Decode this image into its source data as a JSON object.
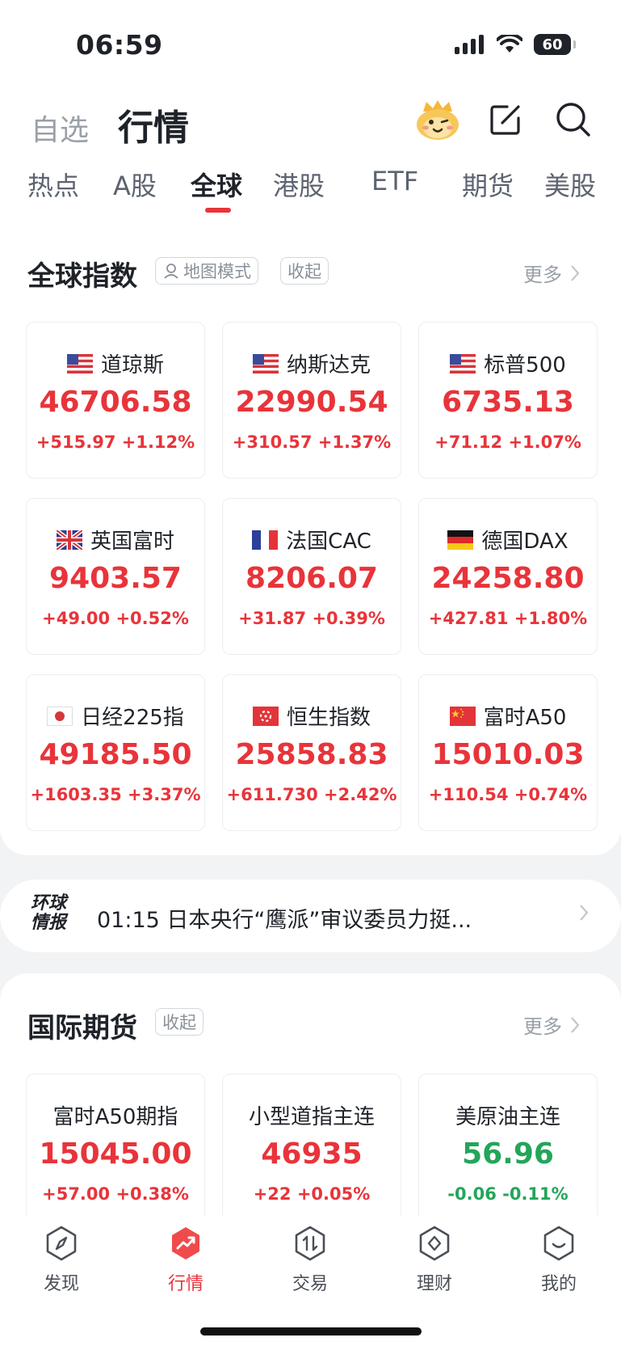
{
  "status_bar": {
    "time": "06:59",
    "battery": "60"
  },
  "header": {
    "tab_watchlist": "自选",
    "tab_market": "行情"
  },
  "market_tabs": [
    "热点",
    "A股",
    "全球",
    "港股",
    "ETF",
    "期货",
    "美股"
  ],
  "global_index": {
    "title": "全球指数",
    "map_mode": "地图模式",
    "collapse": "收起",
    "more": "更多",
    "cards": [
      {
        "name": "道琼斯",
        "flag": "us-flag-icon",
        "price": "46706.58",
        "change": "+515.97 +1.12%"
      },
      {
        "name": "纳斯达克",
        "flag": "us-flag-icon",
        "price": "22990.54",
        "change": "+310.57 +1.37%"
      },
      {
        "name": "标普500",
        "flag": "us-flag-icon",
        "price": "6735.13",
        "change": "+71.12 +1.07%"
      },
      {
        "name": "英国富时",
        "flag": "uk-flag-icon",
        "price": "9403.57",
        "change": "+49.00 +0.52%"
      },
      {
        "name": "法国CAC",
        "flag": "fr-flag-icon",
        "price": "8206.07",
        "change": "+31.87 +0.39%"
      },
      {
        "name": "德国DAX",
        "flag": "de-flag-icon",
        "price": "24258.80",
        "change": "+427.81 +1.80%"
      },
      {
        "name": "日经225指",
        "flag": "jp-flag-icon",
        "price": "49185.50",
        "change": "+1603.35 +3.37%"
      },
      {
        "name": "恒生指数",
        "flag": "hk-flag-icon",
        "price": "25858.83",
        "change": "+611.730 +2.42%"
      },
      {
        "name": "富时A50",
        "flag": "cn-flag-icon",
        "price": "15010.03",
        "change": "+110.54 +0.74%"
      }
    ]
  },
  "news": {
    "logo_line1": "环球",
    "logo_line2": "情报",
    "text": "01:15 日本央行“鹰派”审议委员力挺..."
  },
  "futures": {
    "title": "国际期货",
    "collapse": "收起",
    "more": "更多",
    "cards": [
      {
        "name": "富时A50期指",
        "price": "15045.00",
        "change": "+57.00 +0.38%",
        "direction": "up"
      },
      {
        "name": "小型道指主连",
        "price": "46935",
        "change": "+22 +0.05%",
        "direction": "up"
      },
      {
        "name": "美原油主连",
        "price": "56.96",
        "change": "-0.06 -0.11%",
        "direction": "down"
      }
    ]
  },
  "bottom_nav": [
    "发现",
    "行情",
    "交易",
    "理财",
    "我的"
  ],
  "colors": {
    "up": "#e8343a",
    "down": "#23a55a",
    "accent": "#e8343a"
  }
}
